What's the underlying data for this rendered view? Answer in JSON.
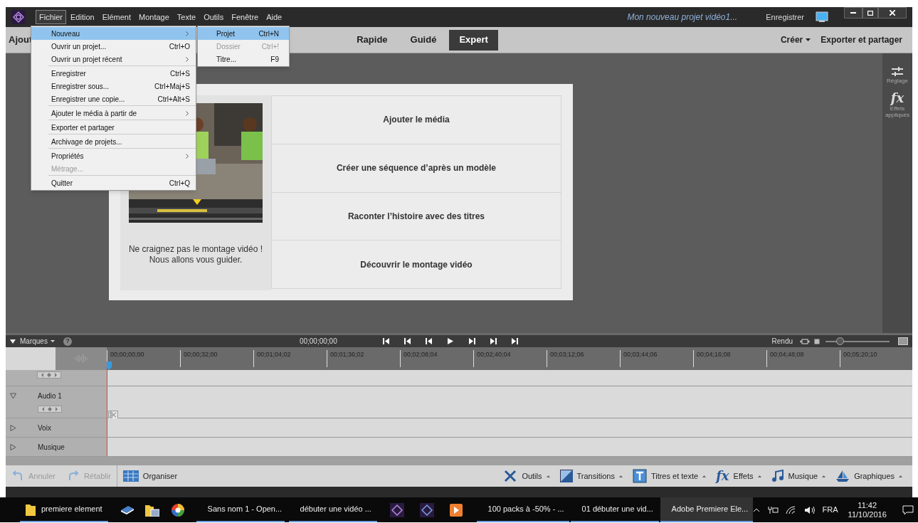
{
  "title_bar": {
    "menu": [
      {
        "label": "Fichier",
        "selected": true
      },
      {
        "label": "Edition",
        "selected": false
      },
      {
        "label": "Elément",
        "selected": false
      },
      {
        "label": "Montage",
        "selected": false
      },
      {
        "label": "Texte",
        "selected": false
      },
      {
        "label": "Outils",
        "selected": false
      },
      {
        "label": "Fenêtre",
        "selected": false
      },
      {
        "label": "Aide",
        "selected": false
      }
    ],
    "project_title": "Mon nouveau projet vidéo1...",
    "save_label": "Enregistrer"
  },
  "file_menu": {
    "groups": [
      [
        {
          "label": "Nouveau",
          "submenu": true,
          "disabled": false,
          "selected": true
        },
        {
          "label": "Ouvrir un projet...",
          "shortcut": "Ctrl+O",
          "submenu": false,
          "disabled": false,
          "selected": false
        },
        {
          "label": "Ouvrir un projet récent",
          "submenu": true,
          "disabled": false,
          "selected": false
        }
      ],
      [
        {
          "label": "Enregistrer",
          "shortcut": "Ctrl+S",
          "submenu": false,
          "disabled": false,
          "selected": false
        },
        {
          "label": "Enregistrer sous...",
          "shortcut": "Ctrl+Maj+S",
          "submenu": false,
          "disabled": false,
          "selected": false
        },
        {
          "label": "Enregistrer une copie...",
          "shortcut": "Ctrl+Alt+S",
          "submenu": false,
          "disabled": false,
          "selected": false
        }
      ],
      [
        {
          "label": "Ajouter le média à partir de",
          "submenu": true,
          "disabled": false,
          "selected": false
        }
      ],
      [
        {
          "label": "Exporter et partager",
          "submenu": false,
          "disabled": false,
          "selected": false
        }
      ],
      [
        {
          "label": "Archivage de projets...",
          "submenu": false,
          "disabled": false,
          "selected": false
        }
      ],
      [
        {
          "label": "Propriétés",
          "submenu": true,
          "disabled": false,
          "selected": false
        },
        {
          "label": "Métrage...",
          "submenu": false,
          "disabled": true,
          "selected": false
        }
      ],
      [
        {
          "label": "Quitter",
          "shortcut": "Ctrl+Q",
          "submenu": false,
          "disabled": false,
          "selected": false
        }
      ]
    ]
  },
  "new_submenu": [
    {
      "label": "Projet",
      "shortcut": "Ctrl+N",
      "disabled": false,
      "selected": true
    },
    {
      "label": "Dossier",
      "shortcut": "Ctrl+!",
      "disabled": true,
      "selected": false
    },
    {
      "label": "Titre...",
      "shortcut": "F9",
      "disabled": false,
      "selected": false
    }
  ],
  "mode_bar": {
    "left_label": "Ajout",
    "tabs": [
      {
        "label": "Rapide",
        "selected": false
      },
      {
        "label": "Guidé",
        "selected": false
      },
      {
        "label": "Expert",
        "selected": true
      }
    ],
    "create_label": "Créer",
    "export_label": "Exporter et partager"
  },
  "right_panel": [
    {
      "label": "Réglage"
    },
    {
      "label": "Effets appliqués",
      "icon_text": "fx"
    }
  ],
  "welcome": {
    "message": "Ne craignez pas le montage vidéo ! Nous allons vous guider.",
    "options": [
      "Ajouter le média",
      "Créer une séquence d’après un modèle",
      "Raconter l’histoire avec des titres",
      "Découvrir le montage vidéo"
    ]
  },
  "timeline": {
    "markers_label": "Marques",
    "help": "?",
    "timecode": "00;00;00;00",
    "render_label": "Rendu",
    "zoom": {
      "level": 0.22
    },
    "ruler": [
      "00;00;00;00",
      "00;00;32;00",
      "00;01;04;02",
      "00;01;36;02",
      "00;02;08;04",
      "00;02;40;04",
      "00;03;12;06",
      "00;03;44;06",
      "00;04;16;08",
      "00;04;48;08",
      "00;05;20;10"
    ],
    "tracks": [
      {
        "name": "Audio 1",
        "expanded": true
      },
      {
        "name": "Voix",
        "expanded": false
      },
      {
        "name": "Musique",
        "expanded": false
      }
    ]
  },
  "toolbar_left": [
    {
      "label": "Annuler",
      "disabled": true
    },
    {
      "label": "Rétablir",
      "disabled": true
    },
    {
      "label": "Organiser",
      "disabled": false
    }
  ],
  "toolbar_right": [
    {
      "label": "Outils"
    },
    {
      "label": "Transitions"
    },
    {
      "label": "Titres et texte"
    },
    {
      "label": "Effets",
      "icon_text": "fx"
    },
    {
      "label": "Musique"
    },
    {
      "label": "Graphiques"
    }
  ],
  "taskbar": {
    "items": [
      {
        "label": "premiere element",
        "active": false
      },
      {
        "label": "Sans nom 1 - Open...",
        "active": false
      },
      {
        "label": "débuter une vidéo ...",
        "active": false
      },
      {
        "label": "100 packs à -50% - ...",
        "active": false
      },
      {
        "label": "01 débuter une vid...",
        "active": false
      },
      {
        "label": "Adobe Premiere Ele...",
        "active": true
      }
    ],
    "language": "FRA",
    "time": "11:42",
    "date": "11/10/2016"
  }
}
